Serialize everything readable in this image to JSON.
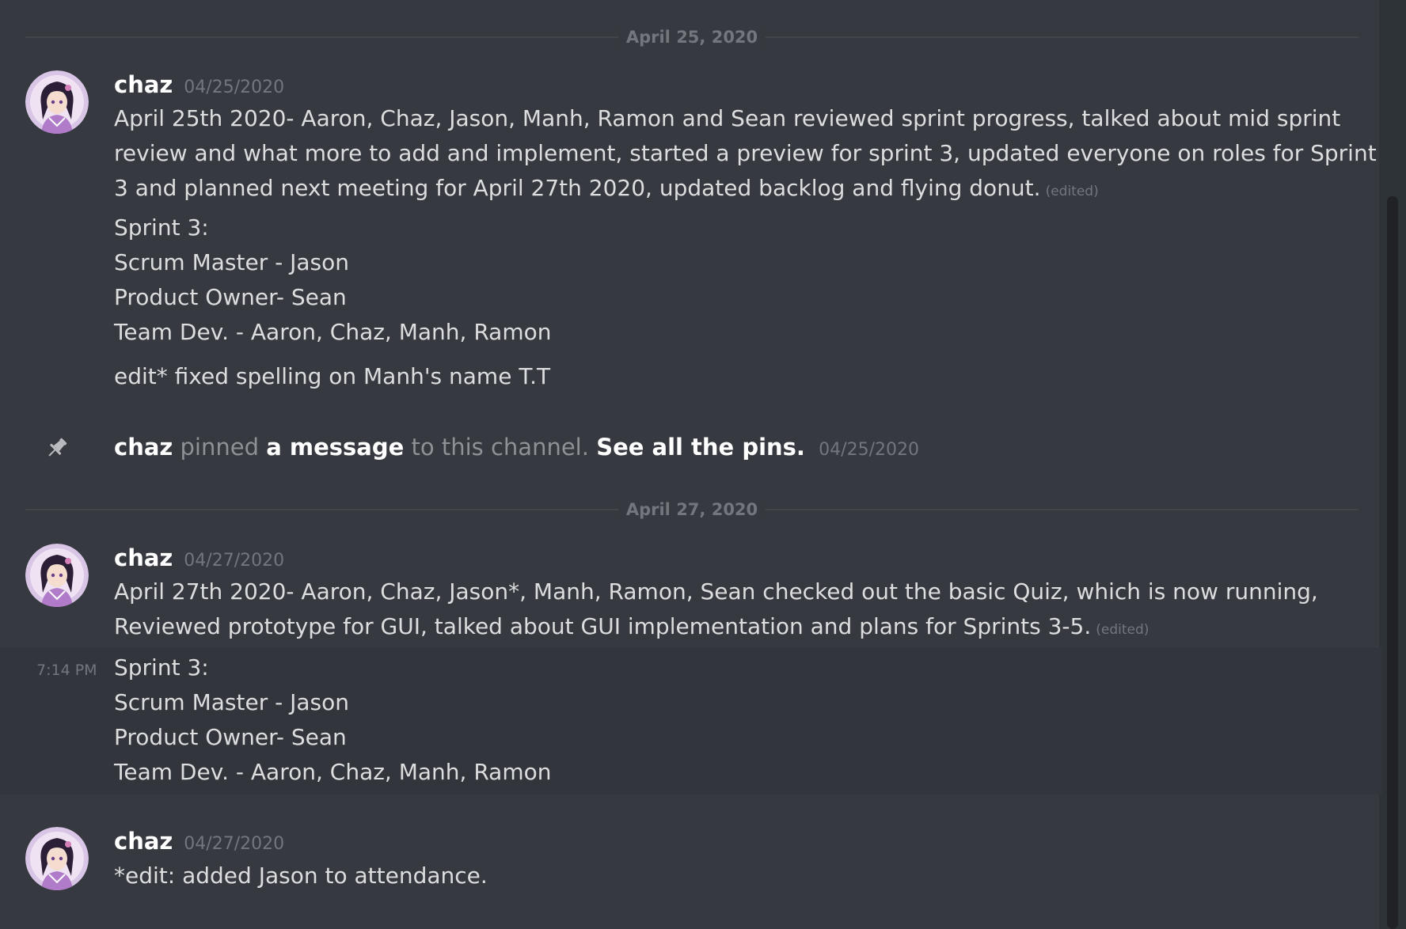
{
  "dividers": [
    {
      "label": "April 25, 2020"
    },
    {
      "label": "April 27, 2020"
    }
  ],
  "messages": [
    {
      "username": "chaz",
      "timestamp": "04/25/2020",
      "avatar_icon": "anime-girl-avatar",
      "lines": [
        "April 25th 2020- Aaron, Chaz, Jason, Manh, Ramon and Sean reviewed sprint progress, talked about mid sprint",
        "review and what more to add and implement, started a preview for sprint 3, updated everyone on roles for Sprint",
        "3 and planned next meeting for April 27th 2020, updated backlog and flying donut."
      ],
      "edited_label": "(edited)",
      "extra_lines": [
        "Sprint 3:",
        "Scrum Master - Jason",
        "Product Owner- Sean",
        "Team Dev. - Aaron, Chaz, Manh, Ramon"
      ],
      "note": "edit* fixed spelling on Manh's name T.T"
    },
    {
      "username": "chaz",
      "timestamp": "04/27/2020",
      "avatar_icon": "anime-girl-avatar",
      "lines": [
        "April 27th 2020- Aaron, Chaz, Jason*, Manh, Ramon, Sean checked out the basic Quiz, which is now running,",
        "Reviewed prototype for GUI, talked about GUI implementation and plans for Sprints 3-5."
      ],
      "edited_label": "(edited)"
    },
    {
      "hover_time": "7:14 PM",
      "lines": [
        "Sprint 3:",
        "Scrum Master - Jason",
        "Product Owner- Sean",
        "Team Dev. - Aaron, Chaz, Manh, Ramon"
      ]
    },
    {
      "username": "chaz",
      "timestamp": "04/27/2020",
      "avatar_icon": "anime-girl-avatar",
      "lines": [
        "*edit: added Jason to attendance."
      ]
    }
  ],
  "system_message": {
    "icon": "pin-icon",
    "actor": "chaz",
    "verb": "pinned",
    "link_message": "a message",
    "middle": "to this channel.",
    "link_pins": "See all the pins.",
    "timestamp": "04/25/2020"
  },
  "colors": {
    "background": "#36393f",
    "hover_background": "#32353b",
    "text": "#dcddde",
    "muted": "#72767d",
    "username": "#ffffff"
  }
}
